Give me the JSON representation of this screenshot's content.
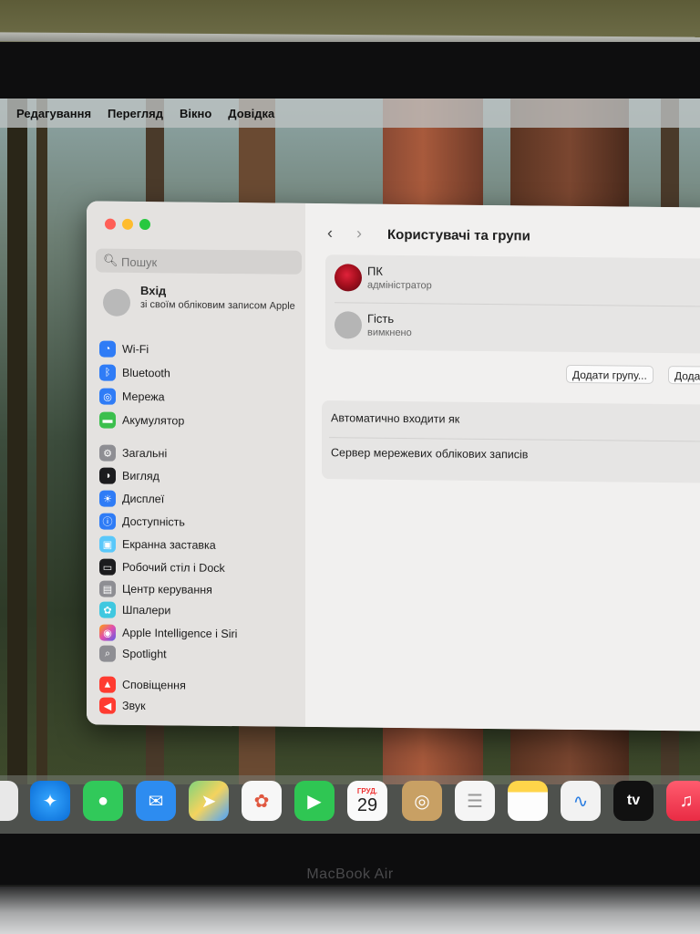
{
  "menubar": {
    "items": [
      "Редагування",
      "Перегляд",
      "Вікно",
      "Довідка"
    ]
  },
  "sidebar": {
    "search_placeholder": "Пошук",
    "account": {
      "title": "Вхід",
      "subtitle": "зі своїм обліковим записом Apple"
    },
    "items": [
      {
        "label": "Wi-Fi",
        "icon": "wifi-icon",
        "color": "#2f7cf6"
      },
      {
        "label": "Bluetooth",
        "icon": "bluetooth-icon",
        "color": "#2f7cf6"
      },
      {
        "label": "Мережа",
        "icon": "globe-icon",
        "color": "#2f7cf6"
      },
      {
        "label": "Акумулятор",
        "icon": "battery-icon",
        "color": "#3bbf4d"
      },
      {
        "label": "Загальні",
        "icon": "gear-icon",
        "color": "#8e8e93"
      },
      {
        "label": "Вигляд",
        "icon": "appearance-icon",
        "color": "#1c1c1e"
      },
      {
        "label": "Дисплеї",
        "icon": "display-icon",
        "color": "#2f7cf6"
      },
      {
        "label": "Доступність",
        "icon": "accessibility-icon",
        "color": "#2f7cf6"
      },
      {
        "label": "Екранна заставка",
        "icon": "screensaver-icon",
        "color": "#5ac8fa"
      },
      {
        "label": "Робочий стіл і Dock",
        "icon": "dock-icon",
        "color": "#1c1c1e"
      },
      {
        "label": "Центр керування",
        "icon": "control-center-icon",
        "color": "#8e8e93"
      },
      {
        "label": "Шпалери",
        "icon": "wallpaper-icon",
        "color": "#40c8e0"
      },
      {
        "label": "Apple Intelligence і Siri",
        "icon": "siri-icon",
        "color": "#e04fb0"
      },
      {
        "label": "Spotlight",
        "icon": "spotlight-icon",
        "color": "#8e8e93"
      },
      {
        "label": "Сповіщення",
        "icon": "notifications-icon",
        "color": "#ff3b30"
      },
      {
        "label": "Звук",
        "icon": "sound-icon",
        "color": "#ff3b30"
      }
    ]
  },
  "pane": {
    "title": "Користувачі та групи",
    "users": [
      {
        "name": "ПК",
        "role": "адміністратор"
      },
      {
        "name": "Гість",
        "role": "вимкнено"
      }
    ],
    "add_group_button": "Додати групу...",
    "add_user_button": "Дода",
    "options": [
      "Автоматично входити як",
      "Сервер мережевих облікових записів"
    ]
  },
  "dock": {
    "apps": [
      "Safari",
      "Messages",
      "Mail",
      "Maps",
      "Photos",
      "FaceTime",
      "Calendar",
      "Contacts",
      "Reminders",
      "Notes",
      "Freeform",
      "Apple TV",
      "Music"
    ],
    "calendar_month": "ГРУД.",
    "calendar_day": "29",
    "tv_label": "tv"
  },
  "device_label": "MacBook Air"
}
